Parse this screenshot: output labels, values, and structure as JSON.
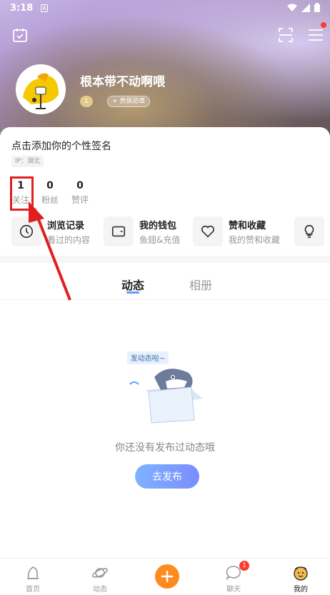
{
  "status_bar": {
    "time": "3:18",
    "notification_letter": "A"
  },
  "profile": {
    "username": "根本带不动啊喂",
    "level_badge": "1",
    "noble_badge": "+ 贵族勋章",
    "signature": "点击添加你的个性签名",
    "ip": "IP：湖北"
  },
  "stats": [
    {
      "num": "1",
      "label": "关注"
    },
    {
      "num": "0",
      "label": "粉丝"
    },
    {
      "num": "0",
      "label": "赞评"
    }
  ],
  "quick_actions": [
    {
      "title": "浏览记录",
      "sub": "看过的内容"
    },
    {
      "title": "我的钱包",
      "sub": "鱼翅&充值"
    },
    {
      "title": "赞和收藏",
      "sub": "我的赞和收藏"
    }
  ],
  "tabs": {
    "dynamic": "动态",
    "album": "相册"
  },
  "empty_state": {
    "bubble": "发动态啦~",
    "text": "你还没有发布过动态哦",
    "button": "去发布"
  },
  "bottom_nav": {
    "home": "首页",
    "dynamic": "动态",
    "chat": "聊天",
    "chat_badge": "1",
    "mine": "我的"
  },
  "colors": {
    "accent_blue": "#5aa0ff",
    "annotation_red": "#e02020",
    "plus_orange": "#ff8a1f"
  }
}
